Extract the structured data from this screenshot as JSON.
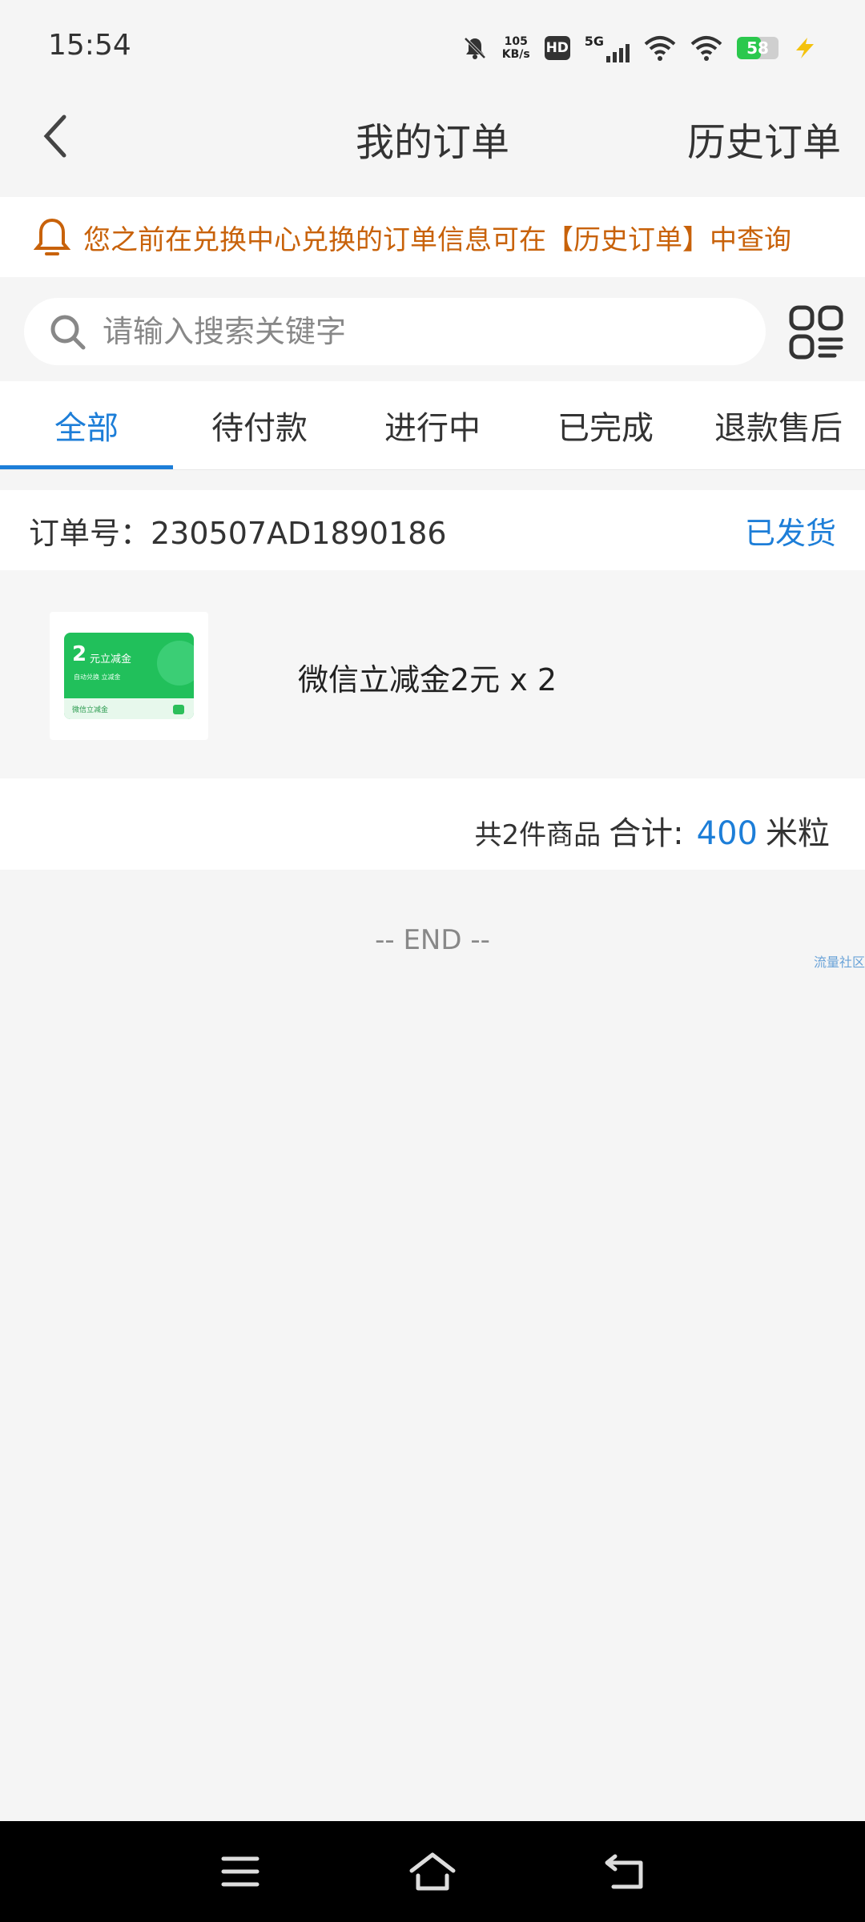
{
  "status_bar": {
    "time": "15:54",
    "net_speed_value": "105",
    "net_speed_unit": "KB/s",
    "hd_label": "HD",
    "signal_label": "5G",
    "battery_level": "58",
    "battery_fraction": 0.58,
    "icons": [
      "bell-off-icon",
      "hd-icon",
      "signal-icon",
      "wifi-icon",
      "wifi-icon",
      "battery-icon",
      "charging-icon"
    ]
  },
  "header": {
    "title": "我的订单",
    "history_link": "历史订单",
    "back_icon": "chevron-left-icon"
  },
  "notice": {
    "text": "您之前在兑换中心兑换的订单信息可在【历史订单】中查询",
    "icon": "bell-icon",
    "color": "#c8620a"
  },
  "search": {
    "placeholder": "请输入搜索关键字",
    "value": "",
    "icon": "search-icon",
    "scan_icon": "scan-menu-icon"
  },
  "tabs": [
    {
      "label": "全部",
      "active": true
    },
    {
      "label": "待付款",
      "active": false
    },
    {
      "label": "进行中",
      "active": false
    },
    {
      "label": "已完成",
      "active": false
    },
    {
      "label": "退款售后",
      "active": false
    }
  ],
  "order": {
    "number_label": "订单号：230507AD1890186",
    "status": "已发货",
    "product": {
      "name": "微信立减金2元 x 2",
      "thumb_big": "2",
      "thumb_title": "元立减金",
      "thumb_sub": "自动兑换 立减金",
      "thumb_footer": "微信立减金"
    },
    "count_text": "共2件商品",
    "total_label": "合计:",
    "total_value": "400",
    "total_unit": "米粒"
  },
  "end_text": "-- END --",
  "watermark": "流量社区",
  "colors": {
    "accent": "#1d7ed8",
    "notice": "#c8620a",
    "coupon_green": "#21c05b"
  },
  "nav_bar": {
    "icons": [
      "menu-icon",
      "home-icon",
      "back-icon"
    ]
  }
}
